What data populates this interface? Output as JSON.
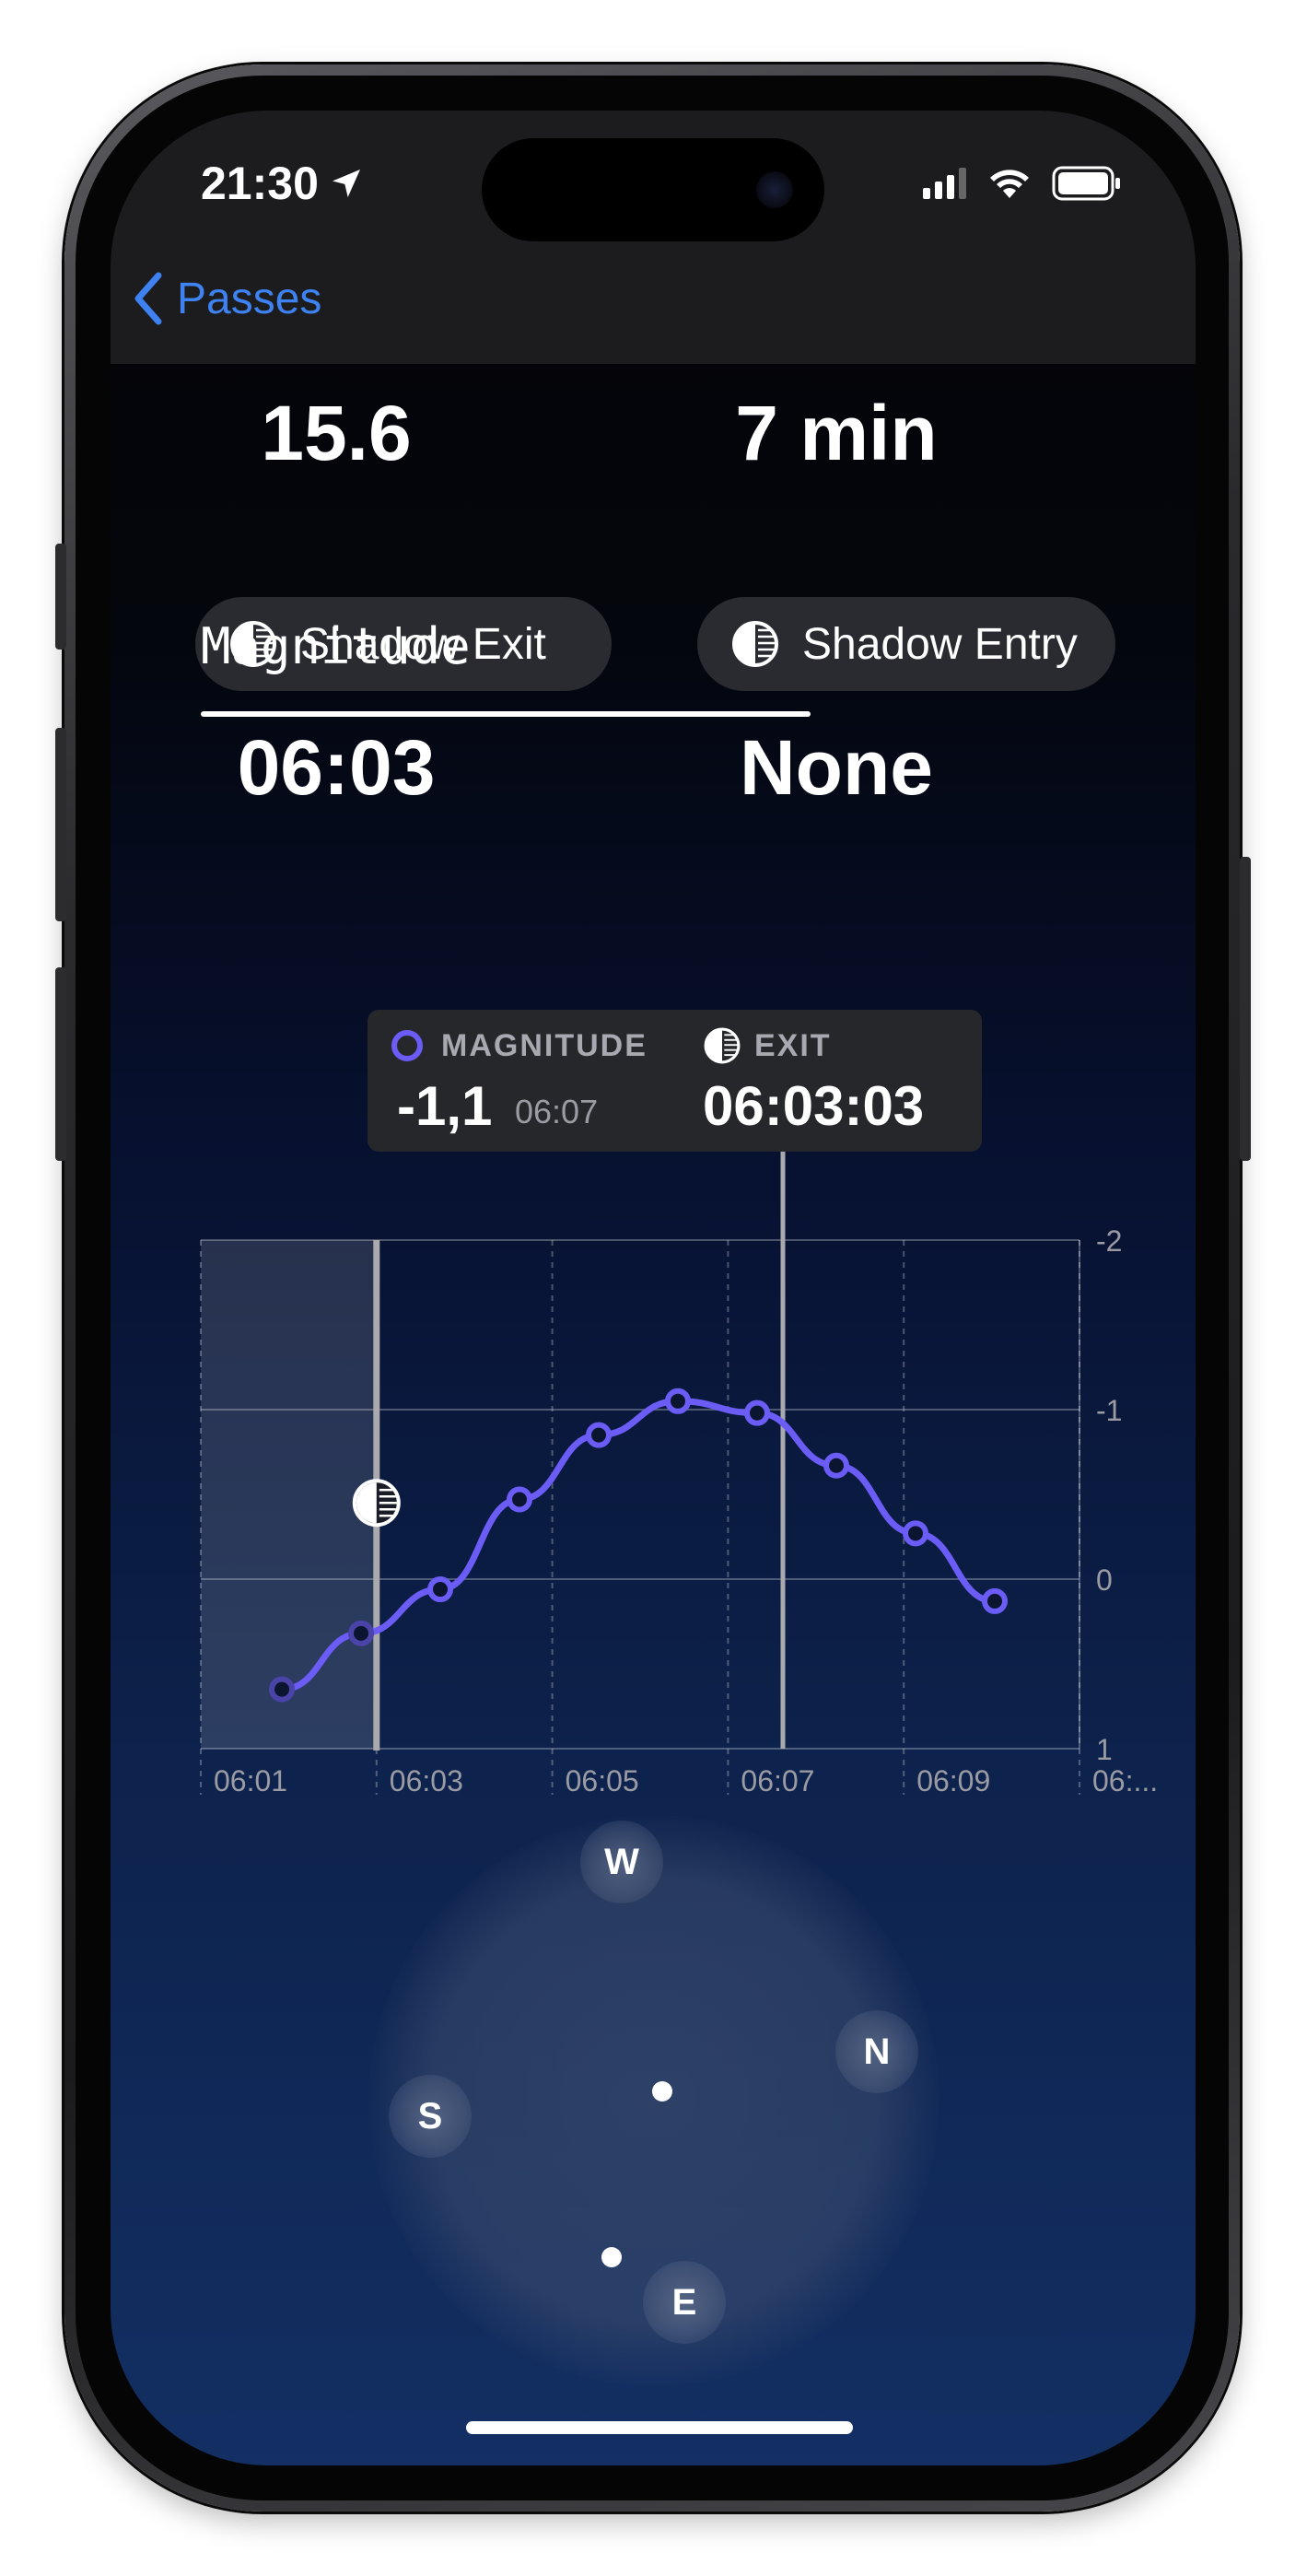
{
  "status": {
    "time": "21:30",
    "icons": [
      "location-arrow-icon",
      "cellular-signal-icon",
      "wifi-icon",
      "battery-icon"
    ]
  },
  "nav": {
    "back_label": "Passes"
  },
  "stats": {
    "left_value": "15.6",
    "right_value": "7 min"
  },
  "shadow": {
    "exit_label": "Shadow Exit",
    "exit_value": "06:03",
    "entry_label": "Shadow Entry",
    "entry_value": "None"
  },
  "section": {
    "tab_label": "Magnitude"
  },
  "tooltip": {
    "magnitude_label": "MAGNITUDE",
    "magnitude_value": "-1,1",
    "magnitude_time": "06:07",
    "exit_label": "EXIT",
    "exit_value": "06:03:03"
  },
  "chart_data": {
    "type": "line",
    "x": [
      "06:01",
      "06:02",
      "06:03",
      "06:04",
      "06:05",
      "06:06",
      "06:07",
      "06:08",
      "06:09",
      "06:10"
    ],
    "y": [
      0.65,
      0.32,
      0.06,
      -0.47,
      -0.85,
      -1.05,
      -0.98,
      -0.67,
      -0.27,
      0.13
    ],
    "x_tick_labels": [
      "06:01",
      "06:03",
      "06:05",
      "06:07",
      "06:09",
      "06:..."
    ],
    "y_tick_labels": [
      "-2",
      "-1",
      "0",
      "1"
    ],
    "ylim": [
      -2,
      1
    ],
    "y_inverted": true,
    "shadow_exit_time": "06:03",
    "selected_time": "06:07",
    "colors": {
      "line": "#6a5cf5",
      "line_shadowed": "#4a43a8"
    }
  },
  "compass": {
    "w": "W",
    "n": "N",
    "s": "S",
    "e": "E"
  }
}
